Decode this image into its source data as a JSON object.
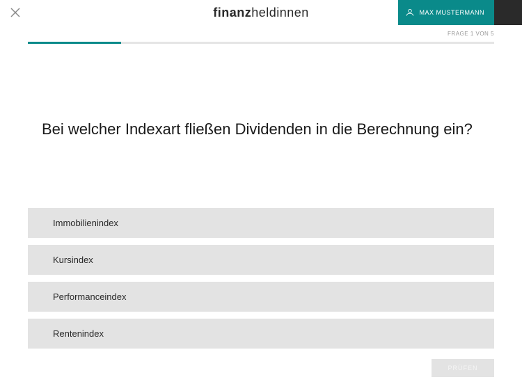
{
  "header": {
    "logo_bold": "finanz",
    "logo_light": "heldinnen",
    "user_name": "MAX MUSTERMANN"
  },
  "progress": {
    "label": "FRAGE 1 VON 5",
    "percent": 20
  },
  "question": {
    "text": "Bei welcher Indexart fließen Dividenden in die Berechnung ein?"
  },
  "answers": [
    {
      "label": "Immobilienindex"
    },
    {
      "label": "Kursindex"
    },
    {
      "label": "Performanceindex"
    },
    {
      "label": "Rentenindex"
    }
  ],
  "footer": {
    "check_label": "PRÜFEN"
  },
  "colors": {
    "accent": "#0a8a8a",
    "dark": "#2a2a2a",
    "option_bg": "#e3e3e3"
  }
}
